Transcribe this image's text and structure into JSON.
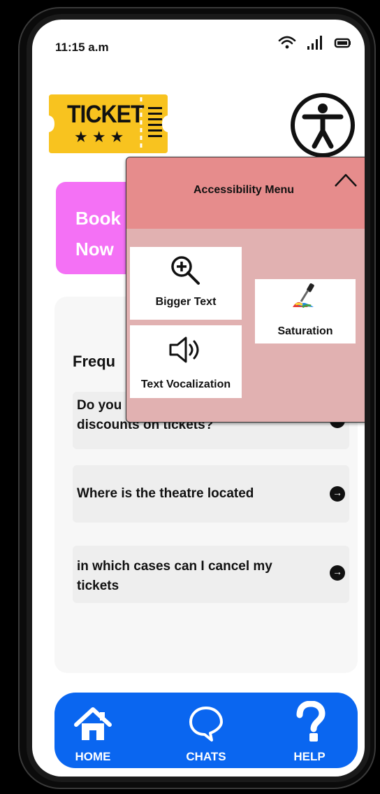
{
  "status_bar": {
    "time": "11:15 a.m"
  },
  "ticket_logo": {
    "text": "TICKET",
    "stars": "★ ★ ★"
  },
  "book_card": {
    "line1": "Book",
    "line2": "Now"
  },
  "faq": {
    "title": "Frequ",
    "items": [
      {
        "line1": "Do you",
        "line2": "discounts on tickets?"
      },
      {
        "line1": "Where is the theatre located"
      },
      {
        "line1": "in which cases can I cancel my",
        "line2": "tickets"
      }
    ]
  },
  "accessibility_menu": {
    "title": "Accessibility Menu",
    "options": [
      {
        "label": "Bigger Text",
        "icon": "magnifier-plus-icon"
      },
      {
        "label": "Saturation",
        "icon": "color-dropper-icon"
      },
      {
        "label": "Text Vocalization",
        "icon": "speaker-icon"
      }
    ]
  },
  "nav": [
    {
      "label": "HOME",
      "icon": "home-icon"
    },
    {
      "label": "CHATS",
      "icon": "chat-icon"
    },
    {
      "label": "HELP",
      "icon": "question-icon"
    }
  ],
  "colors": {
    "book_card": "#f471f5",
    "menu_body": "#e1b1b1",
    "menu_header": "#e68c8c",
    "nav_bar": "#0a66f0",
    "ticket_yellow": "#f8c31f"
  }
}
